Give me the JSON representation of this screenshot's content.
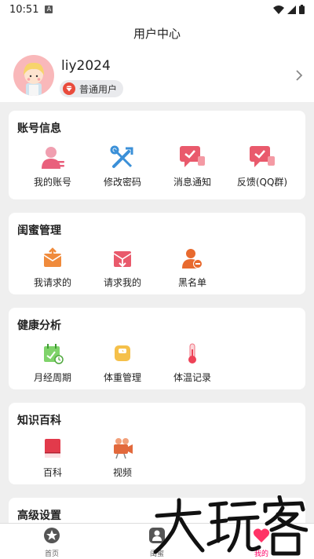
{
  "status_bar": {
    "time": "10:51",
    "a_badge": "A"
  },
  "title": "用户中心",
  "profile": {
    "username": "liy2024",
    "badge_label": "普通用户"
  },
  "sections": [
    {
      "title": "账号信息",
      "items": [
        {
          "label": "我的账号",
          "icon": "user-account-icon"
        },
        {
          "label": "修改密码",
          "icon": "tools-icon"
        },
        {
          "label": "消息通知",
          "icon": "message-check-icon"
        },
        {
          "label": "反馈(QQ群)",
          "icon": "feedback-chat-icon"
        }
      ]
    },
    {
      "title": "闺蜜管理",
      "items": [
        {
          "label": "我请求的",
          "icon": "outgoing-request-icon"
        },
        {
          "label": "请求我的",
          "icon": "incoming-request-icon"
        },
        {
          "label": "黑名单",
          "icon": "blocklist-user-icon"
        }
      ]
    },
    {
      "title": "健康分析",
      "items": [
        {
          "label": "月经周期",
          "icon": "calendar-cycle-icon"
        },
        {
          "label": "体重管理",
          "icon": "weight-scale-icon"
        },
        {
          "label": "体温记录",
          "icon": "thermometer-icon"
        }
      ]
    },
    {
      "title": "知识百科",
      "items": [
        {
          "label": "百科",
          "icon": "book-icon"
        },
        {
          "label": "视频",
          "icon": "video-camera-icon"
        }
      ]
    },
    {
      "title": "高级设置",
      "items": []
    }
  ],
  "bottom_nav": [
    {
      "label": "首页",
      "icon": "star-icon"
    },
    {
      "label": "闺蜜",
      "icon": "friend-icon"
    },
    {
      "label": "我的",
      "icon": "heart-icon"
    }
  ],
  "colors": {
    "accent": "#ff3366",
    "pink": "#ee5f7c",
    "blue": "#3b90d8",
    "orange": "#f08b3c"
  }
}
